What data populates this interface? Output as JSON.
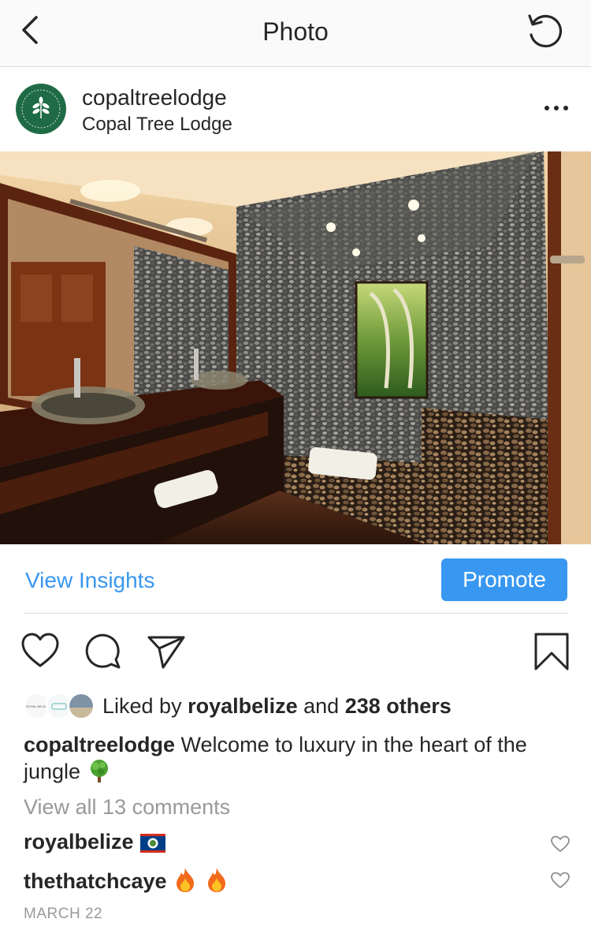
{
  "nav": {
    "title": "Photo"
  },
  "post": {
    "username": "copaltreelodge",
    "location": "Copal Tree Lodge"
  },
  "insights": {
    "view_insights": "View Insights",
    "promote": "Promote"
  },
  "likes": {
    "prefix": "Liked by ",
    "first_liker": "royalbelize",
    "middle": " and ",
    "others": "238 others"
  },
  "caption": {
    "username": "copaltreelodge",
    "text": " Welcome to luxury in the heart of the jungle "
  },
  "comments": {
    "view_all": "View all 13 comments",
    "items": [
      {
        "username": "royalbelize"
      },
      {
        "username": "thethatchcaye"
      }
    ]
  },
  "date": "MARCH 22",
  "colors": {
    "link": "#3897f0",
    "promote_bg": "#3897f0",
    "muted": "#999999",
    "text": "#262626",
    "avatar_green": "#1f6b45"
  }
}
